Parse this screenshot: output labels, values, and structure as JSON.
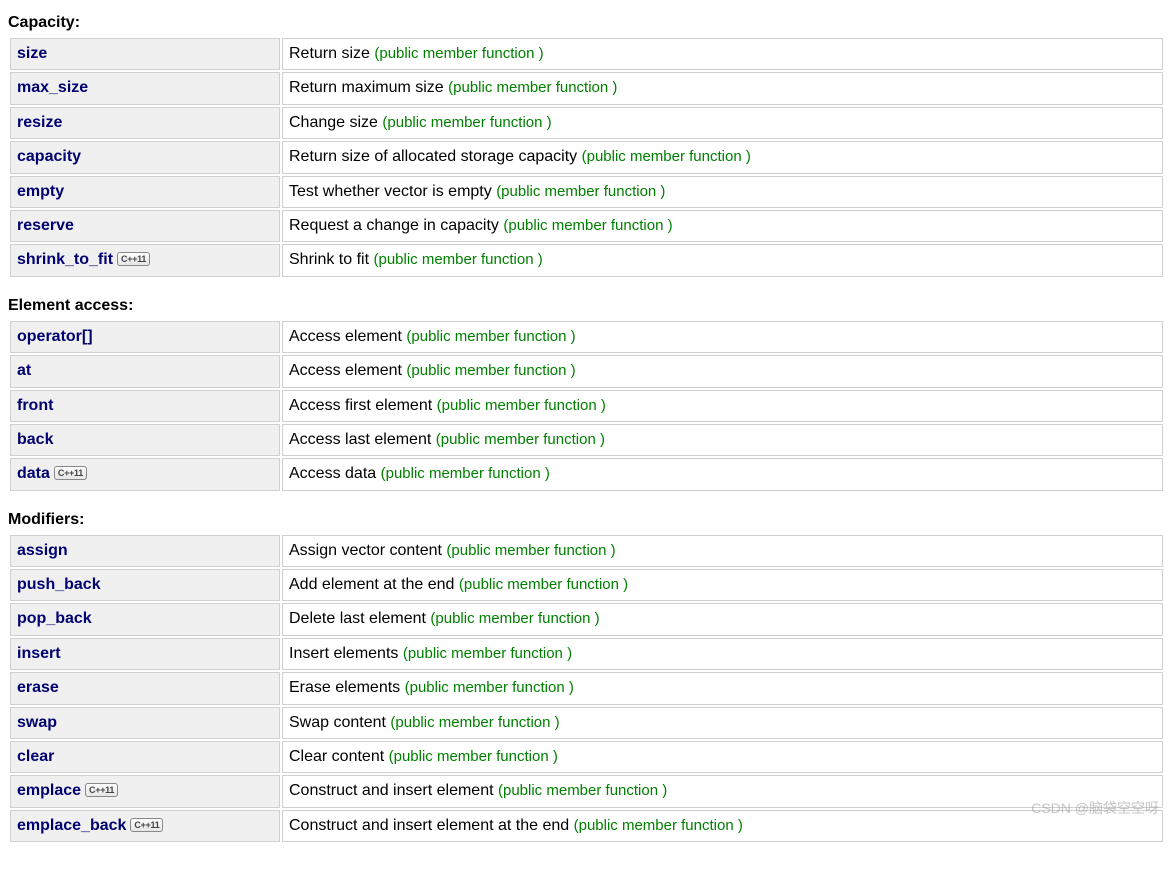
{
  "pmf_label": "(public member function )",
  "cpp11_badge": "C++11",
  "sections": [
    {
      "title": "Capacity:",
      "rows": [
        {
          "name": "size",
          "cpp11": false,
          "desc": "Return size "
        },
        {
          "name": "max_size",
          "cpp11": false,
          "desc": "Return maximum size "
        },
        {
          "name": "resize",
          "cpp11": false,
          "desc": "Change size "
        },
        {
          "name": "capacity",
          "cpp11": false,
          "desc": "Return size of allocated storage capacity "
        },
        {
          "name": "empty",
          "cpp11": false,
          "desc": "Test whether vector is empty "
        },
        {
          "name": "reserve",
          "cpp11": false,
          "desc": "Request a change in capacity "
        },
        {
          "name": "shrink_to_fit",
          "cpp11": true,
          "desc": "Shrink to fit "
        }
      ]
    },
    {
      "title": "Element access:",
      "rows": [
        {
          "name": "operator[]",
          "cpp11": false,
          "desc": "Access element "
        },
        {
          "name": "at",
          "cpp11": false,
          "desc": "Access element "
        },
        {
          "name": "front",
          "cpp11": false,
          "desc": "Access first element "
        },
        {
          "name": "back",
          "cpp11": false,
          "desc": "Access last element "
        },
        {
          "name": "data",
          "cpp11": true,
          "desc": "Access data "
        }
      ]
    },
    {
      "title": "Modifiers:",
      "rows": [
        {
          "name": "assign",
          "cpp11": false,
          "desc": "Assign vector content "
        },
        {
          "name": "push_back",
          "cpp11": false,
          "desc": "Add element at the end "
        },
        {
          "name": "pop_back",
          "cpp11": false,
          "desc": "Delete last element "
        },
        {
          "name": "insert",
          "cpp11": false,
          "desc": "Insert elements "
        },
        {
          "name": "erase",
          "cpp11": false,
          "desc": "Erase elements "
        },
        {
          "name": "swap",
          "cpp11": false,
          "desc": "Swap content "
        },
        {
          "name": "clear",
          "cpp11": false,
          "desc": "Clear content "
        },
        {
          "name": "emplace",
          "cpp11": true,
          "desc": "Construct and insert element "
        },
        {
          "name": "emplace_back",
          "cpp11": true,
          "desc": "Construct and insert element at the end "
        }
      ]
    }
  ],
  "watermark": "CSDN @脑袋空空呀"
}
